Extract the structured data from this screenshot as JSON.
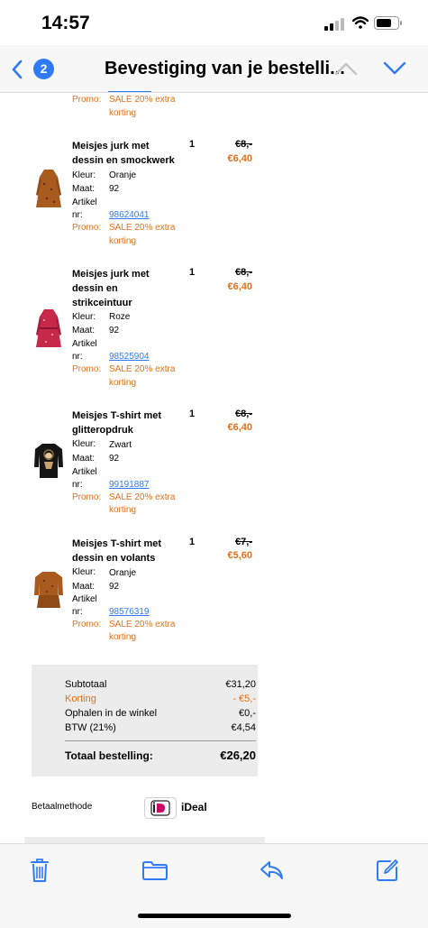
{
  "status": {
    "time": "14:57"
  },
  "nav": {
    "back_count": "2",
    "title": "Bevestiging van je bestelli...",
    "accent": "#2f7bf6"
  },
  "promo_color": "#e27018",
  "top_partial": {
    "promo_label": "Promo:",
    "promo_text_2": "korting"
  },
  "products": [
    {
      "name_lines": [
        "Meisjes jurk met",
        "dessin en smockwerk"
      ],
      "color_label": "Kleur:",
      "color": "Oranje",
      "size_label": "Maat:",
      "size": "92",
      "article_label_1": "Artikel",
      "article_label_2": "nr:",
      "article": "98624041",
      "promo_label": "Promo:",
      "promo_1": "SALE 20% extra",
      "promo_2": "korting",
      "qty": "1",
      "old_price": "€8,-",
      "new_price": "€6,40",
      "thumb": "orange-dress"
    },
    {
      "name_lines": [
        "Meisjes jurk met",
        "dessin en",
        "strikceintuur"
      ],
      "color_label": "Kleur:",
      "color": "Roze",
      "size_label": "Maat:",
      "size": "92",
      "article_label_1": "Artikel",
      "article_label_2": "nr:",
      "article": "98525904",
      "promo_label": "Promo:",
      "promo_1": "SALE 20% extra",
      "promo_2": "korting",
      "qty": "1",
      "old_price": "€8,-",
      "new_price": "€6,40",
      "thumb": "pink-dress"
    },
    {
      "name_lines": [
        "Meisjes T-shirt met",
        "glitteropdruk"
      ],
      "color_label": "Kleur:",
      "color": "Zwart",
      "size_label": "Maat:",
      "size": "92",
      "article_label_1": "Artikel",
      "article_label_2": "nr:",
      "article": "99191887",
      "promo_label": "Promo:",
      "promo_1": "SALE 20% extra",
      "promo_2": "korting",
      "qty": "1",
      "old_price": "€8,-",
      "new_price": "€6,40",
      "thumb": "black-shirt"
    },
    {
      "name_lines": [
        "Meisjes T-shirt met",
        "dessin en volants"
      ],
      "color_label": "Kleur:",
      "color": "Oranje",
      "size_label": "Maat:",
      "size": "92",
      "article_label_1": "Artikel",
      "article_label_2": "nr:",
      "article": "98576319",
      "promo_label": "Promo:",
      "promo_1": "SALE 20% extra",
      "promo_2": "korting",
      "qty": "1",
      "old_price": "€7,-",
      "new_price": "€5,60",
      "thumb": "orange-shirt"
    }
  ],
  "summary": {
    "subtotal_label": "Subtotaal",
    "subtotal": "€31,20",
    "discount_label": "Korting",
    "discount": "- €5,-",
    "pickup_label": "Ophalen in de winkel",
    "pickup": "€0,-",
    "vat_label": "BTW (21%)",
    "vat": "€4,54",
    "total_label": "Totaal bestelling:",
    "total": "€26,20"
  },
  "payment": {
    "label": "Betaalmethode",
    "method": "iDeal"
  },
  "toolbar": {
    "icons": [
      "trash-icon",
      "folder-icon",
      "reply-icon",
      "compose-icon"
    ]
  }
}
